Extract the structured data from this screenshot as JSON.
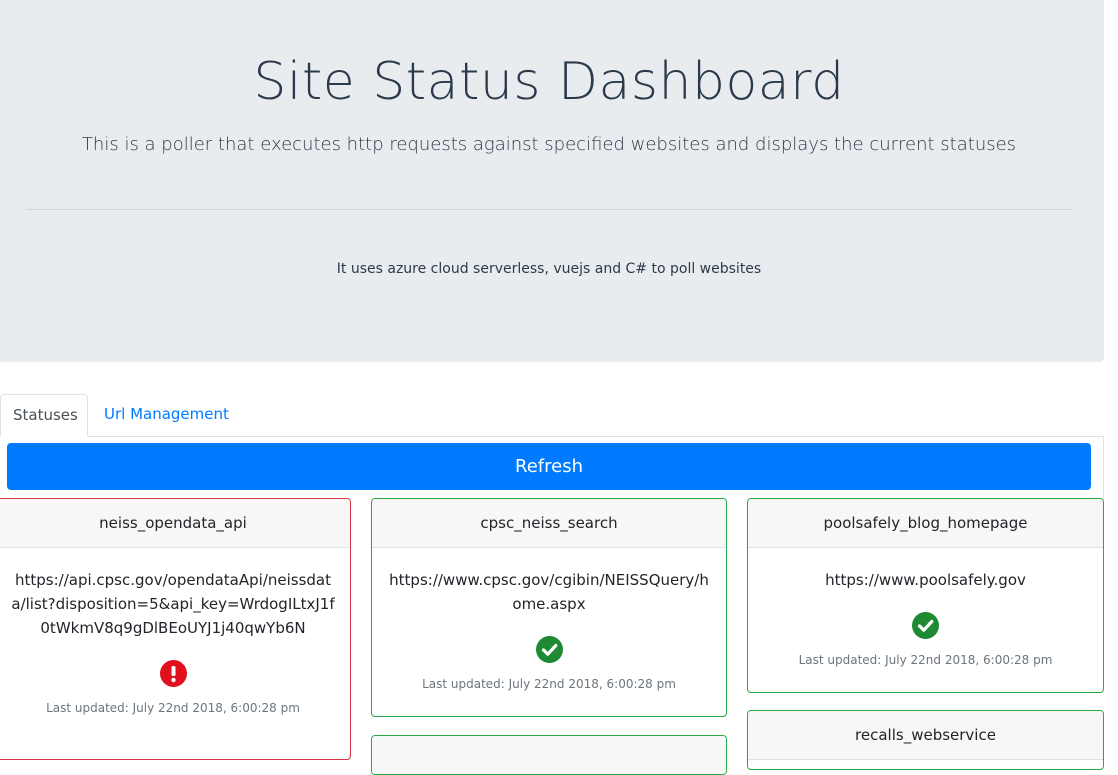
{
  "header": {
    "title": "Site Status Dashboard",
    "lead": "This is a poller that executes http requests against specified websites and displays the current statuses",
    "subtext": "It uses azure cloud serverless, vuejs and C# to poll websites"
  },
  "tabs": [
    {
      "label": "Statuses",
      "active": true
    },
    {
      "label": "Url Management",
      "active": false
    }
  ],
  "refresh_label": "Refresh",
  "colors": {
    "primary": "#007bff",
    "success": "#28a745",
    "danger": "#dc3545"
  },
  "cards": [
    {
      "name": "neiss_opendata_api",
      "url": "https://api.cpsc.gov/opendataApi/neissdata/list?disposition=5&api_key=WrdogILtxJ1f0tWkmV8q9gDlBEoUYJ1j40qwYb6N",
      "status": "down",
      "status_icon": "exclamation-circle-icon",
      "updated": "Last updated: July 22nd 2018, 6:00:28 pm"
    },
    {
      "name": "cpsc_neiss_search",
      "url": "https://www.cpsc.gov/cgibin/NEISSQuery/home.aspx",
      "status": "up",
      "status_icon": "check-circle-icon",
      "updated": "Last updated: July 22nd 2018, 6:00:28 pm"
    },
    {
      "name": "poolsafely_blog_homepage",
      "url": "https://www.poolsafely.gov",
      "status": "up",
      "status_icon": "check-circle-icon",
      "updated": "Last updated: July 22nd 2018, 6:00:28 pm"
    },
    {
      "name": "recalls_webservice",
      "status": "up"
    }
  ]
}
